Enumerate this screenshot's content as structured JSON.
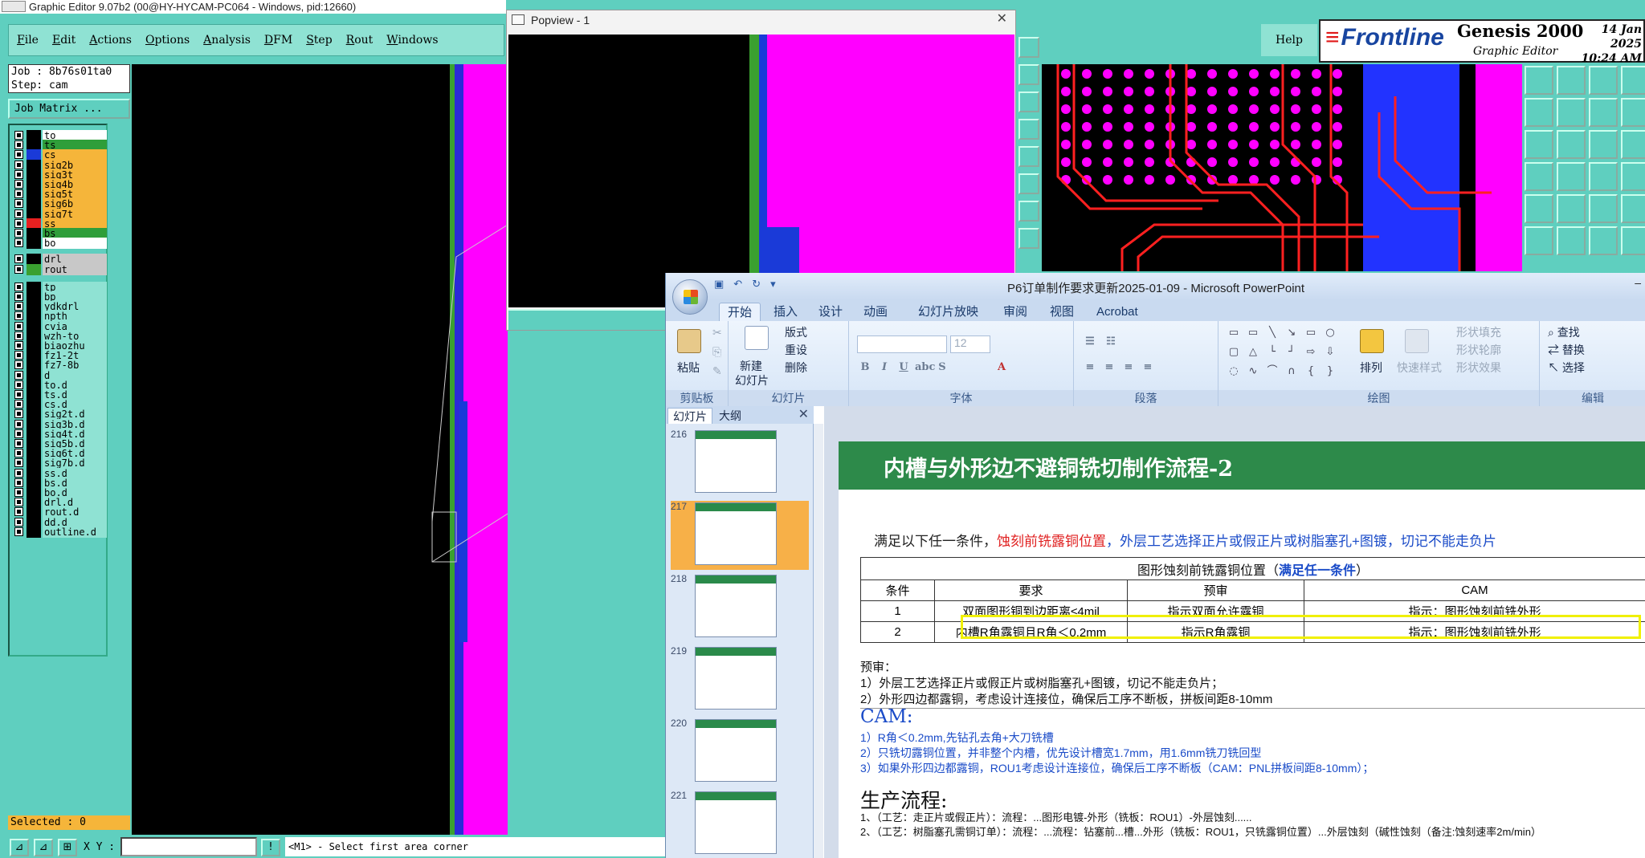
{
  "graphic_editor": {
    "title": "Graphic Editor 9.07b2 (00@HY-HYCAM-PC064 - Windows, pid:12660)",
    "menu": [
      "File",
      "Edit",
      "Actions",
      "Options",
      "Analysis",
      "DFM",
      "Step",
      "Rout",
      "Windows"
    ],
    "help": "Help",
    "brand": {
      "logo": "Frontline",
      "product": "Genesis 2000",
      "sub": "Graphic Editor",
      "date": "14 Jan 2025",
      "time": "10:24 AM"
    },
    "job": "Job : 8b76s01ta0",
    "step": "Step: cam",
    "job_matrix": "Job Matrix ...",
    "layers": [
      {
        "name": "to",
        "color": "#ffffff",
        "swatch": "#000000"
      },
      {
        "name": "ts",
        "color": "#2f9e3a",
        "swatch": "#000000"
      },
      {
        "name": "cs",
        "color": "#f5b53a",
        "swatch": "#1a3ad8"
      },
      {
        "name": "sig2b",
        "color": "#f5b53a",
        "swatch": "#000000"
      },
      {
        "name": "sig3t",
        "color": "#f5b53a",
        "swatch": "#000000"
      },
      {
        "name": "sig4b",
        "color": "#f5b53a",
        "swatch": "#000000"
      },
      {
        "name": "sig5t",
        "color": "#f5b53a",
        "swatch": "#000000"
      },
      {
        "name": "sig6b",
        "color": "#f5b53a",
        "swatch": "#000000"
      },
      {
        "name": "sig7t",
        "color": "#f5b53a",
        "swatch": "#000000"
      },
      {
        "name": "ss",
        "color": "#f5b53a",
        "swatch": "#e82020"
      },
      {
        "name": "bs",
        "color": "#2f9e3a",
        "swatch": "#000000"
      },
      {
        "name": "bo",
        "color": "#ffffff",
        "swatch": "#000000"
      },
      {
        "name": "drl",
        "color": "#c8c8c8",
        "swatch": "#000000"
      },
      {
        "name": "rout",
        "color": "#c8c8c8",
        "swatch": "#3aa030"
      },
      {
        "name": "tp",
        "color": "#8fe2d3",
        "swatch": "#000000"
      },
      {
        "name": "bp",
        "color": "#8fe2d3",
        "swatch": "#000000"
      },
      {
        "name": "ydkdrl",
        "color": "#8fe2d3",
        "swatch": "#000000"
      },
      {
        "name": "npth",
        "color": "#8fe2d3",
        "swatch": "#000000"
      },
      {
        "name": "cvia",
        "color": "#8fe2d3",
        "swatch": "#000000"
      },
      {
        "name": "wzh-to",
        "color": "#8fe2d3",
        "swatch": "#000000"
      },
      {
        "name": "biaozhu",
        "color": "#8fe2d3",
        "swatch": "#000000"
      },
      {
        "name": "fz1-2t",
        "color": "#8fe2d3",
        "swatch": "#000000"
      },
      {
        "name": "fz7-8b",
        "color": "#8fe2d3",
        "swatch": "#000000"
      },
      {
        "name": "d",
        "color": "#8fe2d3",
        "swatch": "#000000"
      },
      {
        "name": "to.d",
        "color": "#8fe2d3",
        "swatch": "#000000"
      },
      {
        "name": "ts.d",
        "color": "#8fe2d3",
        "swatch": "#000000"
      },
      {
        "name": "cs.d",
        "color": "#8fe2d3",
        "swatch": "#000000"
      },
      {
        "name": "sig2t.d",
        "color": "#8fe2d3",
        "swatch": "#000000"
      },
      {
        "name": "sig3b.d",
        "color": "#8fe2d3",
        "swatch": "#000000"
      },
      {
        "name": "sig4t.d",
        "color": "#8fe2d3",
        "swatch": "#000000"
      },
      {
        "name": "sig5b.d",
        "color": "#8fe2d3",
        "swatch": "#000000"
      },
      {
        "name": "sig6t.d",
        "color": "#8fe2d3",
        "swatch": "#000000"
      },
      {
        "name": "sig7b.d",
        "color": "#8fe2d3",
        "swatch": "#000000"
      },
      {
        "name": "ss.d",
        "color": "#8fe2d3",
        "swatch": "#000000"
      },
      {
        "name": "bs.d",
        "color": "#8fe2d3",
        "swatch": "#000000"
      },
      {
        "name": "bo.d",
        "color": "#8fe2d3",
        "swatch": "#000000"
      },
      {
        "name": "drl.d",
        "color": "#8fe2d3",
        "swatch": "#000000"
      },
      {
        "name": "rout.d",
        "color": "#8fe2d3",
        "swatch": "#000000"
      },
      {
        "name": "dd.d",
        "color": "#8fe2d3",
        "swatch": "#000000"
      },
      {
        "name": "outline.d",
        "color": "#8fe2d3",
        "swatch": "#000000"
      }
    ],
    "selected": "Selected : 0",
    "xy_label": "X Y :",
    "message": "<M1> - Select first area corner"
  },
  "popview": {
    "title": "Popview - 1",
    "close": "✕"
  },
  "powerpoint": {
    "title": "P6订单制作要求更新2025-01-09 - Microsoft PowerPoint",
    "tabs": [
      "开始",
      "插入",
      "设计",
      "动画",
      "幻灯片放映",
      "审阅",
      "视图",
      "Acrobat"
    ],
    "ribbon": {
      "clipboard": {
        "label": "剪贴板",
        "paste": "粘贴"
      },
      "slides": {
        "label": "幻灯片",
        "new": "新建",
        "new2": "幻灯片",
        "layout": "版式",
        "reset": "重设",
        "delete": "删除"
      },
      "font": {
        "label": "字体",
        "size": "12"
      },
      "paragraph": {
        "label": "段落"
      },
      "drawing": {
        "label": "绘图",
        "arrange": "排列",
        "quick": "快速样式",
        "fill": "形状填充",
        "outline": "形状轮廓",
        "effect": "形状效果"
      },
      "editing": {
        "label": "编辑",
        "find": "查找",
        "replace": "替换",
        "select": "选择"
      }
    },
    "pane_tabs": [
      "幻灯片",
      "大纲"
    ],
    "thumbs": [
      "216",
      "217",
      "218",
      "219",
      "220",
      "221"
    ],
    "slide": {
      "title": "内槽与外形边不避铜铣切制作流程-2",
      "cond_k": "满足以下任一条件，",
      "cond_r": "蚀刻前铣露铜位置",
      "cond_b": "，外层工艺选择正片或假正片或树脂塞孔+图镀，切记不能走负片",
      "table_cap": "图形蚀刻前铣露铜位置（",
      "table_cap_hl": "满足任一条件",
      "table_cap_end": "）",
      "headers": [
        "条件",
        "要求",
        "预审",
        "CAM"
      ],
      "rows": [
        [
          "1",
          "双面图形铜到边距离≤4mil",
          "指示双面允许露铜",
          "指示：图形蚀刻前铣外形"
        ],
        [
          "2",
          "内槽R角露铜且R角＜0.2mm",
          "指示R角露铜",
          "指示：图形蚀刻前铣外形"
        ]
      ],
      "notes": [
        "预审：",
        "1）外层工艺选择正片或假正片或树脂塞孔+图镀，切记不能走负片；",
        "2）外形四边都露铜，考虑设计连接位，确保后工序不断板，拼板间距8-10mm"
      ],
      "cam_h": "CAM:",
      "cam": [
        "1）R角＜0.2mm,先钻孔去角+大刀铣槽",
        "2）只铣切露铜位置，并非整个内槽，优先设计槽宽1.7mm，用1.6mm铣刀铣回型",
        "3）如果外形四边都露铜，ROU1考虑设计连接位，确保后工序不断板（CAM：PNL拼板间距8-10mm）；"
      ],
      "prod_h": "生产流程:",
      "prod": [
        "1、（工艺：走正片或假正片）：流程：...图形电镀-外形（铣板：ROU1）-外层蚀刻......",
        "2、（工艺：树脂塞孔需铜订单）：流程：...流程：钻塞前...槽...外形（铣板：ROU1，只铣露铜位置）...外层蚀刻（碱性蚀刻（备注:蚀刻速率2m/min）"
      ]
    }
  }
}
